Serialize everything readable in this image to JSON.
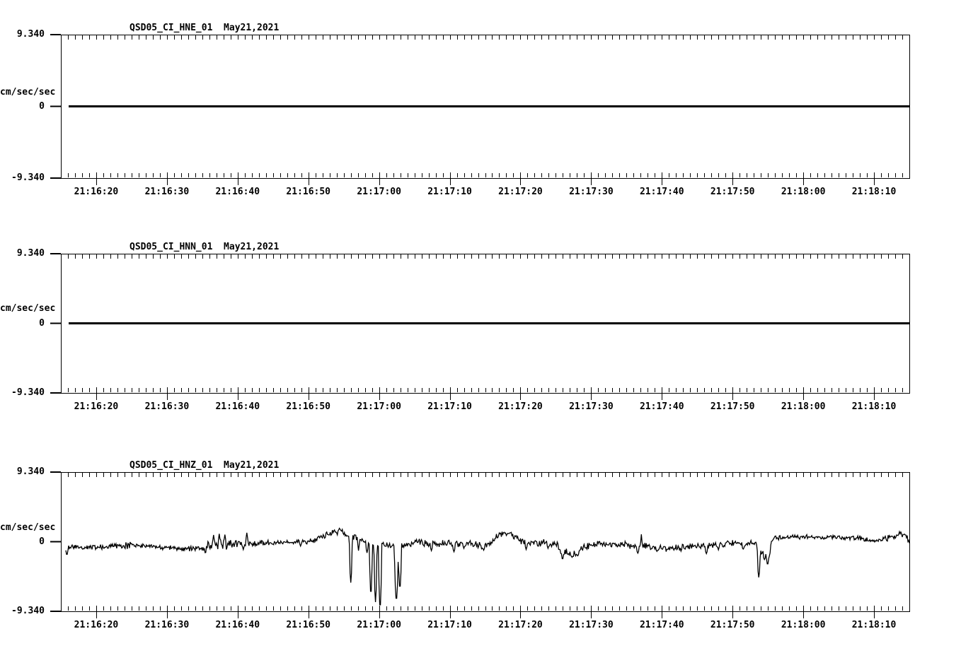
{
  "window": {
    "background_color": "#ffffff",
    "foreground_color": "#000000",
    "station": "QSD05",
    "network": "CI",
    "date_label": "May21,2021"
  },
  "chart_data": [
    {
      "type": "line",
      "panel": "top",
      "channel": "HNE",
      "title": "QSD05_CI_HNE_01  May21,2021",
      "ylabel": "cm/sec/sec",
      "ylim": [
        -9.34,
        9.34
      ],
      "yticks": [
        9.34,
        0,
        -9.34
      ],
      "ytick_labels": [
        "9.340",
        "0",
        "-9.340"
      ],
      "xtick_seconds": [
        20,
        30,
        40,
        50,
        60,
        70,
        80,
        90,
        100,
        110,
        120,
        130
      ],
      "xtick_labels": [
        "21:16:20",
        "21:16:30",
        "21:16:40",
        "21:16:50",
        "21:17:00",
        "21:17:10",
        "21:17:20",
        "21:17:30",
        "21:17:40",
        "21:17:50",
        "21:18:00",
        "21:18:10"
      ],
      "xlim_seconds_after_21_16_00": [
        15,
        135
      ],
      "minor_tick_interval_seconds": 1,
      "grid": "off",
      "legend": "none",
      "series": {
        "kind": "flat",
        "value": 0,
        "t_start": 16.1,
        "t_end": 135,
        "stroke_width": 3
      }
    },
    {
      "type": "line",
      "panel": "middle",
      "channel": "HNN",
      "title": "QSD05_CI_HNN_01  May21,2021",
      "ylabel": "cm/sec/sec",
      "ylim": [
        -9.34,
        9.34
      ],
      "yticks": [
        9.34,
        0,
        -9.34
      ],
      "ytick_labels": [
        "9.340",
        "0",
        "-9.340"
      ],
      "xtick_seconds": [
        20,
        30,
        40,
        50,
        60,
        70,
        80,
        90,
        100,
        110,
        120,
        130
      ],
      "xtick_labels": [
        "21:16:20",
        "21:16:30",
        "21:16:40",
        "21:16:50",
        "21:17:00",
        "21:17:10",
        "21:17:20",
        "21:17:30",
        "21:17:40",
        "21:17:50",
        "21:18:00",
        "21:18:10"
      ],
      "xlim_seconds_after_21_16_00": [
        15,
        135
      ],
      "minor_tick_interval_seconds": 1,
      "grid": "off",
      "legend": "none",
      "series": {
        "kind": "flat",
        "value": 0,
        "t_start": 16.1,
        "t_end": 135,
        "stroke_width": 3
      }
    },
    {
      "type": "line",
      "panel": "bottom",
      "channel": "HNZ",
      "title": "QSD05_CI_HNZ_01  May21,2021",
      "ylabel": "cm/sec/sec",
      "ylim": [
        -9.34,
        9.34
      ],
      "yticks": [
        9.34,
        0,
        -9.34
      ],
      "ytick_labels": [
        "9.340",
        "0",
        "-9.340"
      ],
      "xtick_seconds": [
        20,
        30,
        40,
        50,
        60,
        70,
        80,
        90,
        100,
        110,
        120,
        130
      ],
      "xtick_labels": [
        "21:16:20",
        "21:16:30",
        "21:16:40",
        "21:16:50",
        "21:17:00",
        "21:17:10",
        "21:17:20",
        "21:17:30",
        "21:17:40",
        "21:17:50",
        "21:18:00",
        "21:18:10"
      ],
      "xlim_seconds_after_21_16_00": [
        15,
        135
      ],
      "minor_tick_interval_seconds": 1,
      "grid": "off",
      "legend": "none",
      "series": {
        "kind": "noisy",
        "t_start": 15.7,
        "t_end": 135,
        "dt": 0.1,
        "seed": 987654321,
        "stroke_width": 1.3,
        "baseline": [
          [
            15.7,
            -0.7
          ],
          [
            18,
            -0.7
          ],
          [
            22,
            -0.62
          ],
          [
            25,
            -0.48
          ],
          [
            27,
            -0.62
          ],
          [
            30,
            -0.8
          ],
          [
            31.5,
            -0.95
          ],
          [
            33.5,
            -1.0
          ],
          [
            36,
            -0.62
          ],
          [
            39,
            -0.3
          ],
          [
            42,
            -0.25
          ],
          [
            44,
            -0.12
          ],
          [
            47,
            -0.05
          ],
          [
            50,
            0.0
          ],
          [
            51.5,
            0.45
          ],
          [
            53,
            1.05
          ],
          [
            54.5,
            1.45
          ],
          [
            55.2,
            0.95
          ],
          [
            55.6,
            0.75
          ],
          [
            56.4,
            0.72
          ],
          [
            57.5,
            0.35
          ],
          [
            58.6,
            -0.2
          ],
          [
            59.2,
            -0.45
          ],
          [
            61,
            -0.42
          ],
          [
            63.3,
            -0.5
          ],
          [
            64.5,
            -0.2
          ],
          [
            66,
            -0.12
          ],
          [
            68,
            -0.28
          ],
          [
            70,
            -0.2
          ],
          [
            72.5,
            -0.3
          ],
          [
            74.5,
            -0.55
          ],
          [
            75.8,
            -0.1
          ],
          [
            77,
            1.0
          ],
          [
            78,
            1.25
          ],
          [
            79,
            0.7
          ],
          [
            79.8,
            0.25
          ],
          [
            81,
            -0.05
          ],
          [
            83,
            -0.2
          ],
          [
            85,
            -0.35
          ],
          [
            86,
            -1.25
          ],
          [
            87,
            -1.5
          ],
          [
            87.9,
            -1.6
          ],
          [
            88.6,
            -0.85
          ],
          [
            89.5,
            -0.5
          ],
          [
            91,
            -0.3
          ],
          [
            93,
            -0.5
          ],
          [
            95,
            -0.35
          ],
          [
            96.5,
            -0.7
          ],
          [
            97.5,
            -0.45
          ],
          [
            99,
            -0.75
          ],
          [
            101,
            -0.95
          ],
          [
            102.5,
            -0.85
          ],
          [
            104.5,
            -0.5
          ],
          [
            106,
            -0.65
          ],
          [
            107.5,
            -0.4
          ],
          [
            109,
            -0.3
          ],
          [
            110.5,
            -0.12
          ],
          [
            111.5,
            -0.45
          ],
          [
            112.5,
            -0.25
          ],
          [
            113.3,
            -0.05
          ],
          [
            113.9,
            -1.5
          ],
          [
            114.7,
            -1.85
          ],
          [
            115.25,
            -1.6
          ],
          [
            115.55,
            0.3
          ],
          [
            116.5,
            0.55
          ],
          [
            118,
            0.6
          ],
          [
            120,
            0.65
          ],
          [
            122,
            0.6
          ],
          [
            124,
            0.65
          ],
          [
            126,
            0.55
          ],
          [
            128,
            0.5
          ],
          [
            129.5,
            0.15
          ],
          [
            131,
            0.1
          ],
          [
            132.5,
            0.75
          ],
          [
            133.5,
            0.95
          ],
          [
            134.3,
            1.0
          ],
          [
            134.7,
            0.6
          ],
          [
            135,
            -0.1
          ]
        ],
        "noise_amp": [
          [
            15.7,
            0.3
          ],
          [
            20,
            0.25
          ],
          [
            24,
            0.3
          ],
          [
            29,
            0.2
          ],
          [
            33,
            0.25
          ],
          [
            35.5,
            0.5
          ],
          [
            39,
            0.45
          ],
          [
            43,
            0.25
          ],
          [
            47,
            0.18
          ],
          [
            50,
            0.22
          ],
          [
            53,
            0.28
          ],
          [
            56,
            0.3
          ],
          [
            59,
            0.25
          ],
          [
            63.5,
            0.3
          ],
          [
            68,
            0.33
          ],
          [
            73,
            0.3
          ],
          [
            77,
            0.28
          ],
          [
            81,
            0.33
          ],
          [
            85,
            0.35
          ],
          [
            88,
            0.4
          ],
          [
            90,
            0.33
          ],
          [
            100,
            0.3
          ],
          [
            105,
            0.28
          ],
          [
            110,
            0.25
          ],
          [
            113,
            0.28
          ],
          [
            116,
            0.2
          ],
          [
            122,
            0.18
          ],
          [
            127,
            0.18
          ],
          [
            130,
            0.25
          ],
          [
            133,
            0.28
          ],
          [
            135,
            0.25
          ]
        ],
        "spikes": [
          [
            15.85,
            -1.75,
            0.2
          ],
          [
            36.6,
            0.9,
            0.15
          ],
          [
            37.4,
            1.05,
            0.15
          ],
          [
            38.2,
            0.95,
            0.15
          ],
          [
            40.8,
            -1.05,
            0.15
          ],
          [
            41.3,
            1.2,
            0.15
          ],
          [
            48.9,
            -0.6,
            0.15
          ],
          [
            54.4,
            1.8,
            0.15
          ],
          [
            56.0,
            -5.5,
            0.22
          ],
          [
            57.1,
            -1.2,
            0.15
          ],
          [
            58.3,
            -1.5,
            0.18
          ],
          [
            58.85,
            -7.0,
            0.22
          ],
          [
            59.5,
            -8.1,
            0.22
          ],
          [
            60.15,
            -8.8,
            0.25
          ],
          [
            62.45,
            -7.8,
            0.3
          ],
          [
            62.95,
            -6.2,
            0.25
          ],
          [
            67.4,
            -1.2,
            0.18
          ],
          [
            70.6,
            -1.35,
            0.2
          ],
          [
            72.0,
            -0.9,
            0.15
          ],
          [
            74.8,
            -1.15,
            0.18
          ],
          [
            80.8,
            -1.05,
            0.18
          ],
          [
            83.9,
            -0.9,
            0.15
          ],
          [
            85.95,
            -2.35,
            0.2
          ],
          [
            87.3,
            -2.1,
            0.2
          ],
          [
            88.1,
            -1.9,
            0.18
          ],
          [
            96.6,
            -1.55,
            0.2
          ],
          [
            97.1,
            1.0,
            0.12
          ],
          [
            99.3,
            -1.3,
            0.18
          ],
          [
            106.3,
            -1.6,
            0.2
          ],
          [
            108.0,
            -1.1,
            0.15
          ],
          [
            111.5,
            -1.0,
            0.2
          ],
          [
            113.7,
            -4.8,
            0.22
          ],
          [
            114.5,
            -2.4,
            0.18
          ],
          [
            114.95,
            -3.05,
            0.2
          ],
          [
            133.8,
            1.3,
            0.12
          ]
        ]
      }
    }
  ]
}
